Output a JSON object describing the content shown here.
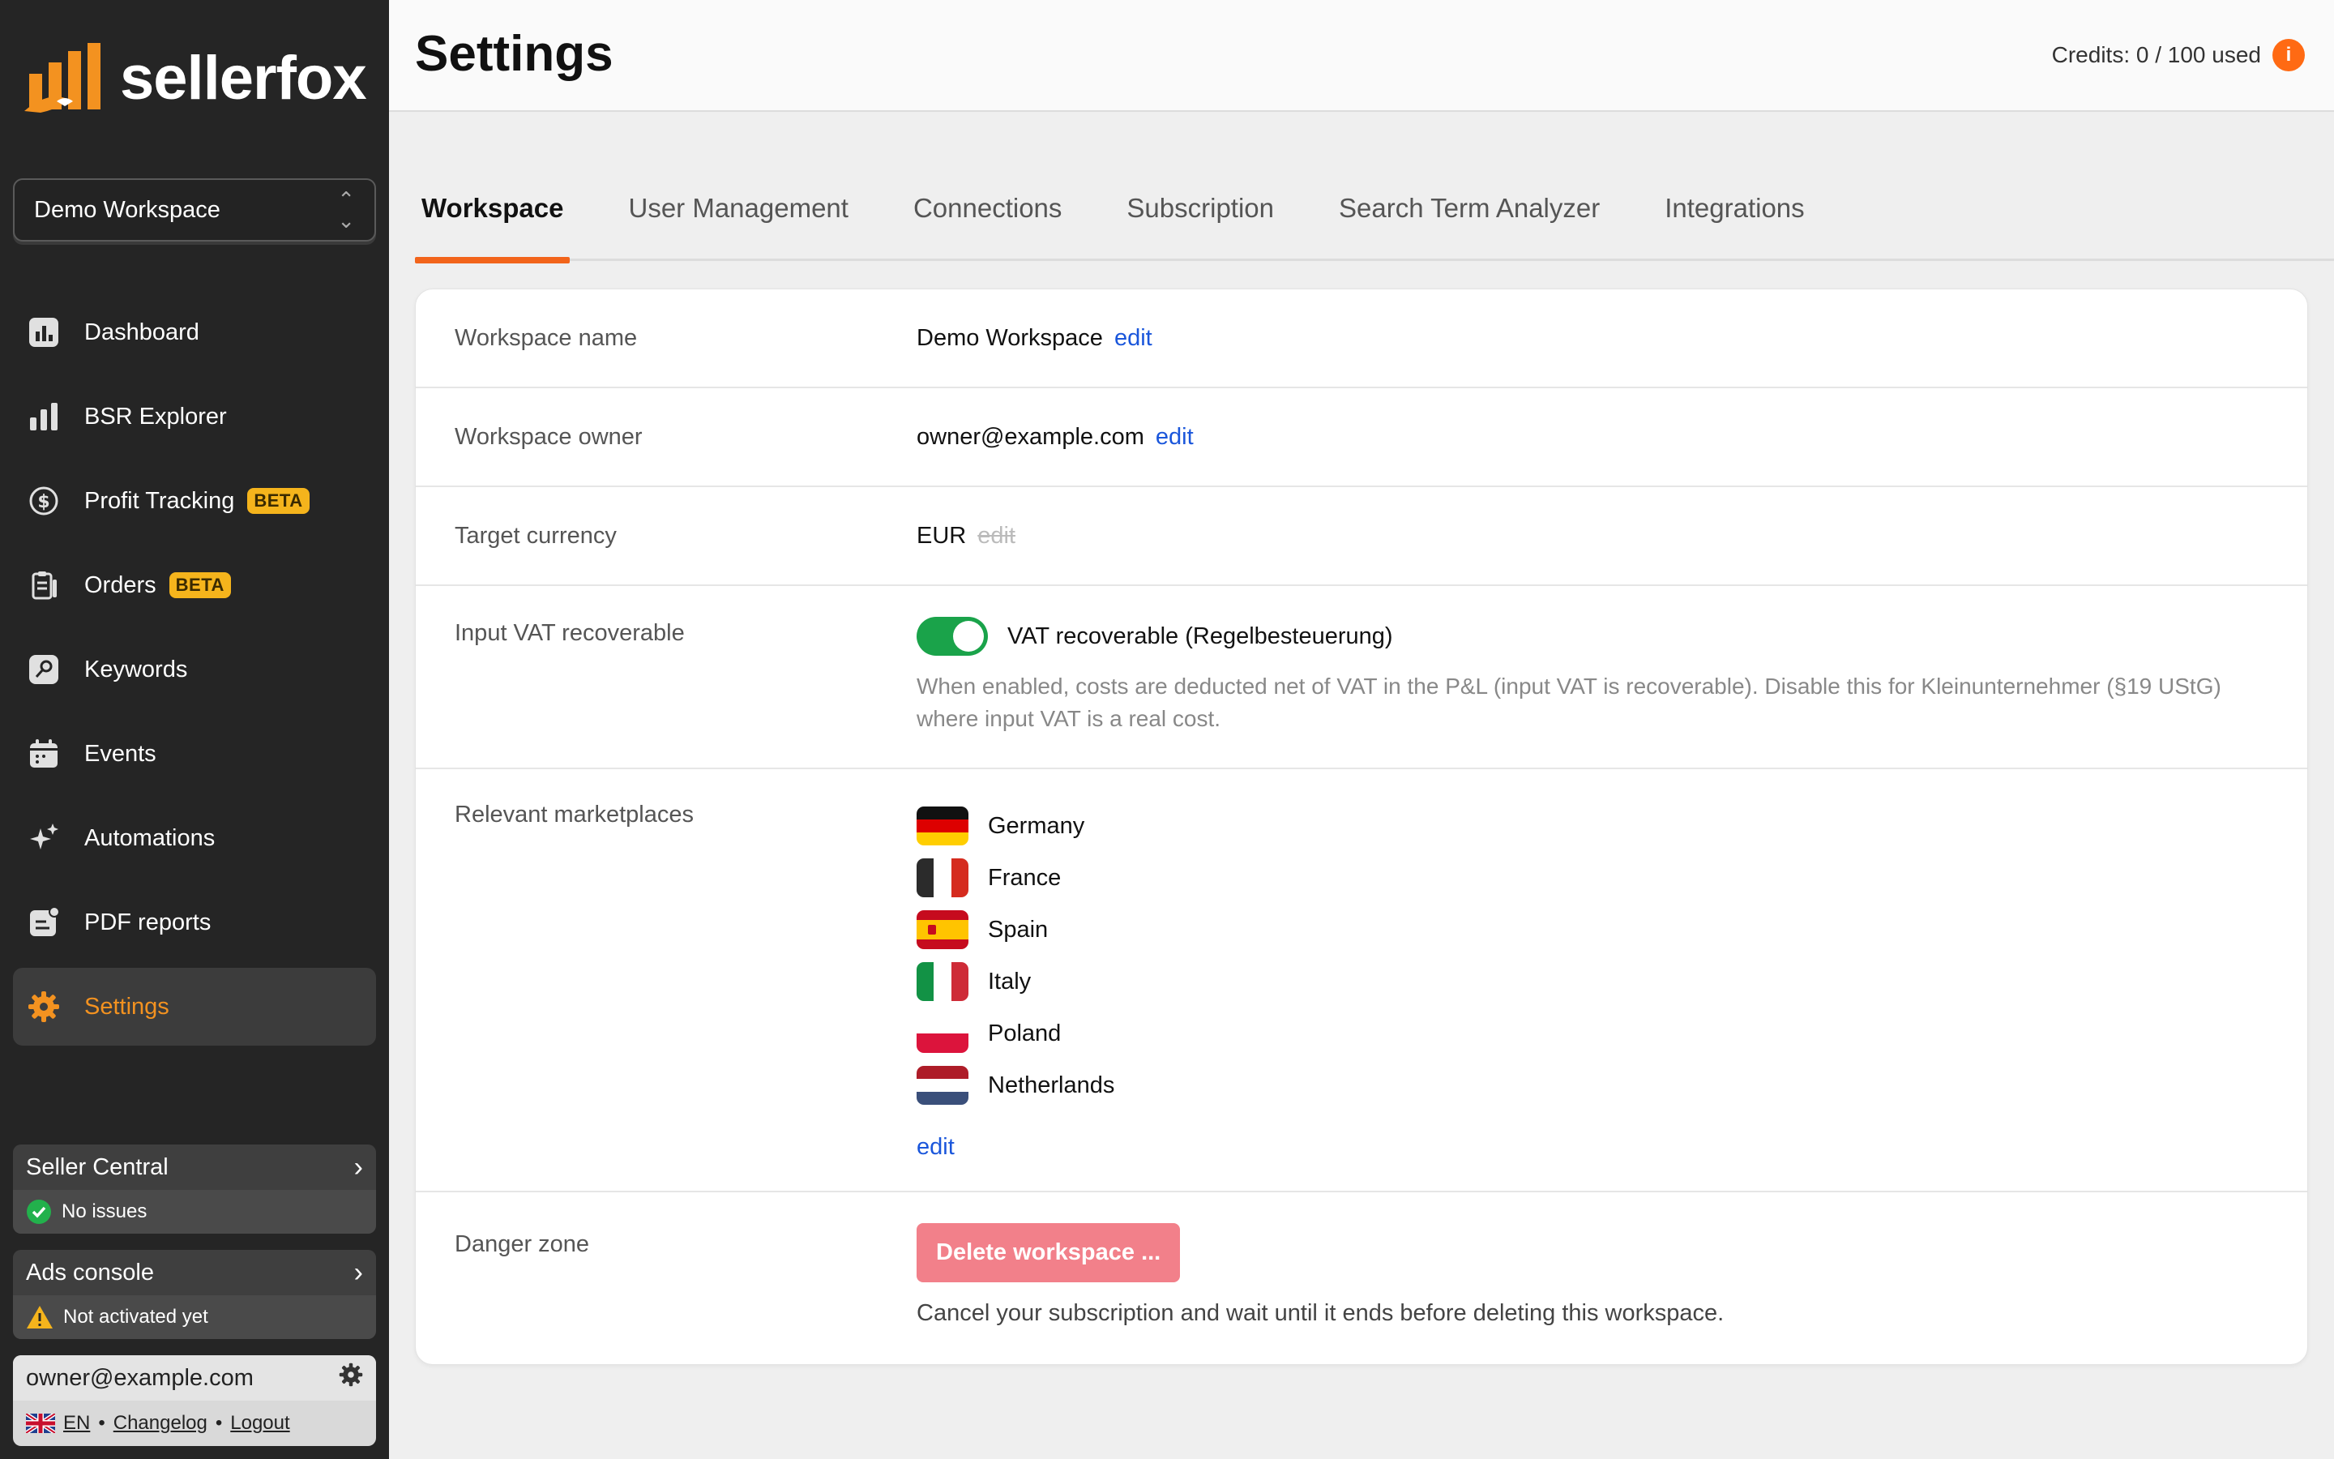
{
  "brand": {
    "name": "sellerfox",
    "accent": "#f39220"
  },
  "workspace_select": {
    "value": "Demo Workspace"
  },
  "nav": {
    "dashboard": "Dashboard",
    "bsr": "BSR Explorer",
    "profit": "Profit Tracking",
    "orders": "Orders",
    "keywords": "Keywords",
    "events": "Events",
    "automations": "Automations",
    "pdf": "PDF reports",
    "settings": "Settings",
    "beta": "BETA"
  },
  "status": {
    "seller_central": {
      "title": "Seller Central",
      "status": "No issues"
    },
    "ads_console": {
      "title": "Ads console",
      "status": "Not activated yet"
    }
  },
  "user": {
    "email": "owner@example.com",
    "lang": "EN",
    "changelog": "Changelog",
    "logout": "Logout",
    "sep": "•"
  },
  "header": {
    "title": "Settings",
    "credits": "Credits: 0 / 100 used",
    "info": "i"
  },
  "tabs": {
    "workspace": "Workspace",
    "users": "User Management",
    "connections": "Connections",
    "subscription": "Subscription",
    "sta": "Search Term Analyzer",
    "integrations": "Integrations"
  },
  "settings": {
    "name": {
      "label": "Workspace name",
      "value": "Demo Workspace",
      "edit": "edit"
    },
    "owner": {
      "label": "Workspace owner",
      "value": "owner@example.com",
      "edit": "edit"
    },
    "currency": {
      "label": "Target currency",
      "value": "EUR",
      "edit": "edit"
    },
    "vat": {
      "label": "Input VAT recoverable",
      "toggle_label": "VAT recoverable (Regelbesteuerung)",
      "enabled": true,
      "hint": "When enabled, costs are deducted net of VAT in the P&L (input VAT is recoverable). Disable this for Kleinunternehmer (§19 UStG) where input VAT is a real cost."
    },
    "marketplaces": {
      "label": "Relevant marketplaces",
      "items": [
        "Germany",
        "France",
        "Spain",
        "Italy",
        "Poland",
        "Netherlands"
      ],
      "edit": "edit"
    },
    "danger": {
      "label": "Danger zone",
      "button": "Delete workspace ...",
      "note": "Cancel your subscription and wait until it ends before deleting this workspace."
    }
  }
}
